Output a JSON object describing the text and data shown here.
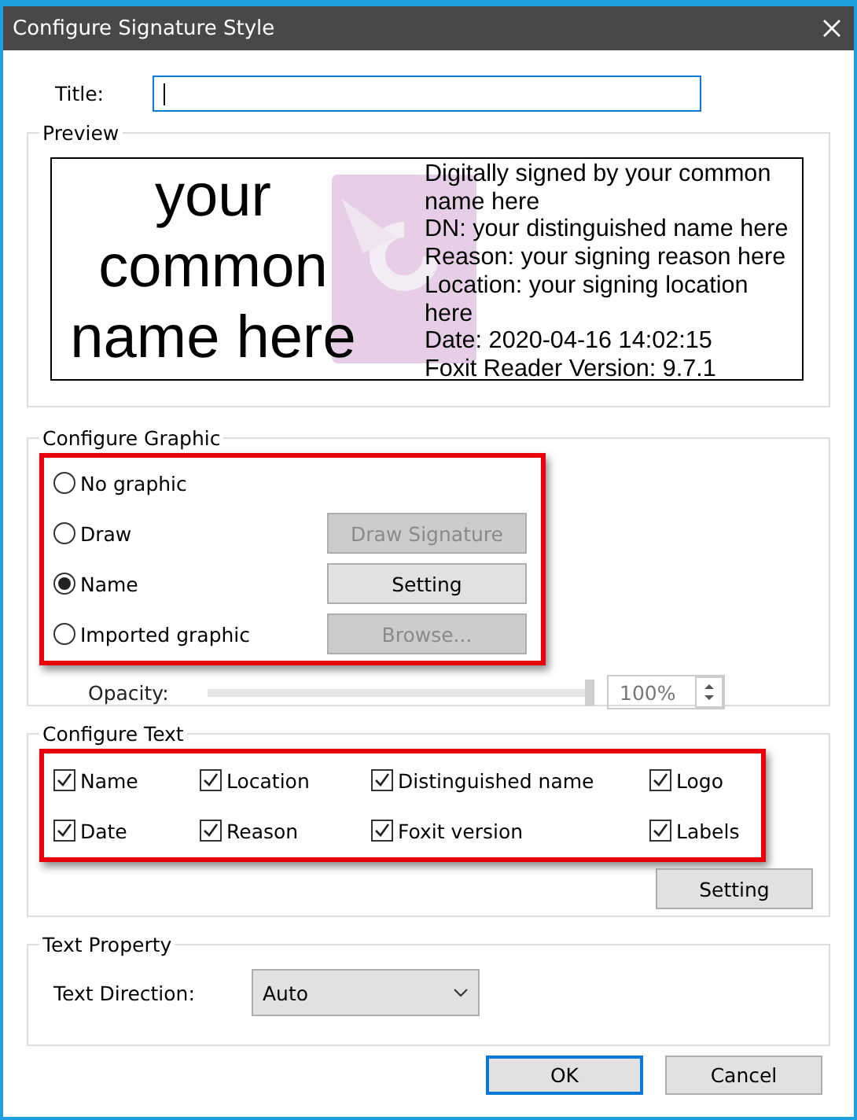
{
  "window": {
    "title": "Configure Signature Style"
  },
  "title_field": {
    "label": "Title:",
    "focused": true
  },
  "preview": {
    "legend": "Preview",
    "name_text": "your common name here",
    "details": [
      "Digitally signed by your common name here",
      "DN: your distinguished name here",
      "Reason: your signing reason here",
      "Location: your signing location here",
      "Date: 2020-04-16 14:02:15",
      "Foxit Reader Version: 9.7.1"
    ]
  },
  "configure_graphic": {
    "legend": "Configure Graphic",
    "highlighted": true,
    "options": [
      {
        "label": "No graphic",
        "selected": false
      },
      {
        "label": "Draw",
        "selected": false,
        "button": {
          "label": "Draw Signature",
          "disabled": true
        }
      },
      {
        "label": "Name",
        "selected": true,
        "button": {
          "label": "Setting",
          "disabled": false
        }
      },
      {
        "label": "Imported graphic",
        "selected": false,
        "button": {
          "label": "Browse...",
          "disabled": true
        }
      }
    ],
    "opacity": {
      "label": "Opacity:",
      "level": 1,
      "value": "100%",
      "disabled": true
    }
  },
  "configure_text": {
    "legend": "Configure Text",
    "highlighted": true,
    "options": [
      {
        "label": "Name",
        "checked": true
      },
      {
        "label": "Location",
        "checked": true
      },
      {
        "label": "Distinguished name",
        "checked": true
      },
      {
        "label": "Logo",
        "checked": true
      },
      {
        "label": "Date",
        "checked": true
      },
      {
        "label": "Reason",
        "checked": true
      },
      {
        "label": "Foxit version",
        "checked": true
      },
      {
        "label": "Labels",
        "checked": true
      }
    ],
    "button": "Setting"
  },
  "text_property": {
    "legend": "Text Property",
    "label": "Text Direction:",
    "value": "Auto"
  },
  "buttons": [
    {
      "label": "OK",
      "default": true
    },
    {
      "label": "Cancel",
      "default": false
    }
  ]
}
